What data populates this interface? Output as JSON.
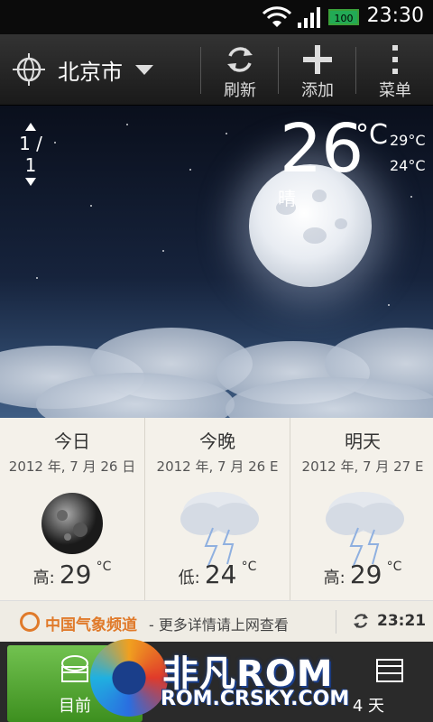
{
  "status": {
    "time": "23:30",
    "battery": "100"
  },
  "top_bar": {
    "city": "北京市",
    "refresh_label": "刷新",
    "add_label": "添加",
    "menu_label": "菜单"
  },
  "current": {
    "page_indicator": "1 / 1",
    "temp": "26",
    "unit": "°C",
    "high": "29°C",
    "low": "24°C",
    "condition": "晴"
  },
  "forecast": [
    {
      "title": "今日",
      "date": "2012 年, 7 月 26 日",
      "temp_label": "高:",
      "temp": "29",
      "unit": "°C",
      "icon": "moon-icon"
    },
    {
      "title": "今晚",
      "date": "2012 年, 7 月 26 E",
      "temp_label": "低:",
      "temp": "24",
      "unit": "°C",
      "icon": "thunderstorm-icon"
    },
    {
      "title": "明天",
      "date": "2012 年, 7 月 27 E",
      "temp_label": "高:",
      "temp": "29",
      "unit": "°C",
      "icon": "thunderstorm-icon"
    }
  ],
  "info_bar": {
    "brand": "中国气象频道",
    "more": "- 更多详情请上网查看",
    "update_time": "23:21"
  },
  "tabs": {
    "now": "目前",
    "four_day": "4 天"
  },
  "watermark": {
    "title": "非凡ROM",
    "url": "ROM.CRSKY.COM"
  },
  "colors": {
    "accent_green": "#5bb03a",
    "brand_orange": "#e07a2a"
  }
}
